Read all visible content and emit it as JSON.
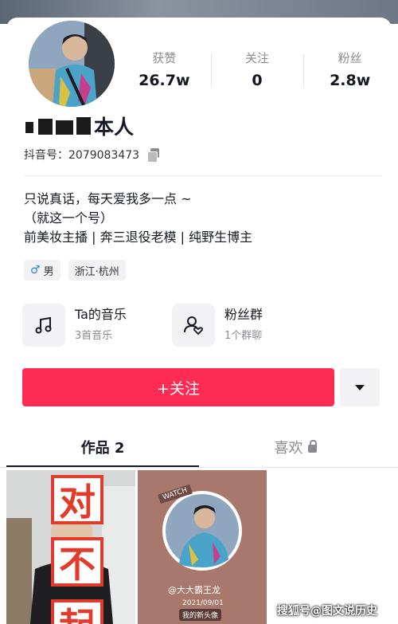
{
  "stats": [
    {
      "label": "获赞",
      "value": "26.7w"
    },
    {
      "label": "关注",
      "value": "0"
    },
    {
      "label": "粉丝",
      "value": "2.8w"
    }
  ],
  "profile": {
    "name_suffix": "本人",
    "id_text": "抖音号：2079083473"
  },
  "bio": {
    "line1": "只说真话，每天爱我多一点 ~",
    "line2": "（就这一个号）",
    "line3": "前美妆主播 | 奔三退役老模 | 纯野生博主"
  },
  "tags": {
    "gender_symbol": "♂",
    "gender": "男",
    "location": "浙江·杭州"
  },
  "features": {
    "music_title": "Ta的音乐",
    "music_sub": "3首音乐",
    "fans_title": "粉丝群",
    "fans_sub": "1个群聊"
  },
  "actions": {
    "follow_label": "+关注"
  },
  "tabs": {
    "works": "作品 2",
    "likes": "喜欢"
  },
  "thumbs": {
    "t1_chars": [
      "对",
      "不",
      "起"
    ],
    "t2_watch": "WATCH",
    "t2_name": "@大大霸王龙",
    "t2_date": "2021/09/01",
    "t2_badge": "我的新头像"
  },
  "watermark": "搜狐号@图文说历史",
  "colors": {
    "accent": "#fe2c55",
    "male": "#2b82f5"
  }
}
